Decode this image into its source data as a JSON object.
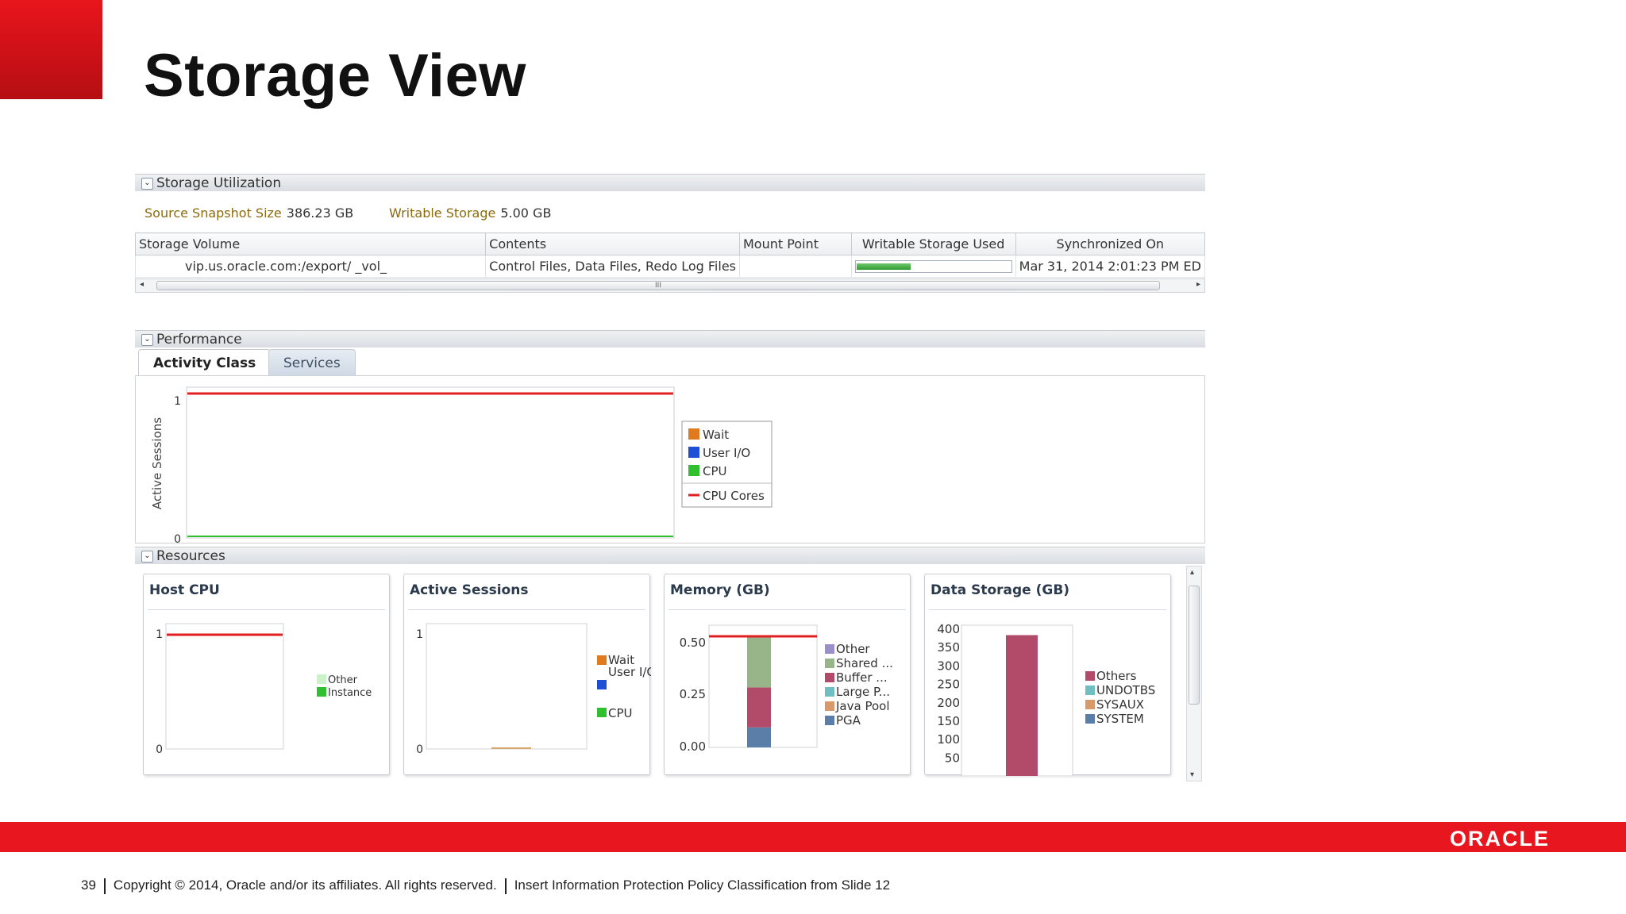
{
  "slide": {
    "title": "Storage View",
    "page_number": "39",
    "copyright": "Copyright © 2014, Oracle and/or its affiliates. All rights reserved.",
    "classification": "Insert Information Protection Policy Classification from Slide 12",
    "logo": "ORACLE",
    "brand_color": "#e8161e"
  },
  "storage_utilization": {
    "header": "Storage Utilization",
    "source_snapshot_label": "Source Snapshot Size",
    "source_snapshot_value": "386.23 GB",
    "writable_storage_label": "Writable Storage",
    "writable_storage_value": "5.00 GB",
    "columns": [
      "Storage Volume",
      "Contents",
      "Mount Point",
      "Writable Storage Used",
      "Synchronized On"
    ],
    "row": {
      "volume": "vip.us.oracle.com:/export/ _vol_",
      "contents": "Control Files, Data Files, Redo Log Files",
      "mount_point": "",
      "writable_used_fraction": 0.35,
      "synchronized_on": "Mar 31, 2014 2:01:23 PM ED"
    },
    "scroll_grip": "III"
  },
  "performance": {
    "header": "Performance",
    "tabs": [
      "Activity Class",
      "Services"
    ],
    "chart_data": {
      "type": "area",
      "ylabel": "Active Sessions",
      "ylim": [
        0,
        1
      ],
      "yticks": [
        "1",
        "0"
      ],
      "series": [
        {
          "name": "Wait",
          "color": "#e07a1f"
        },
        {
          "name": "User I/O",
          "color": "#1f4fd6"
        },
        {
          "name": "CPU",
          "color": "#2fbf2f"
        },
        {
          "name": "CPU Cores",
          "color": "#e02020",
          "value": 1
        }
      ]
    }
  },
  "resources": {
    "header": "Resources",
    "cards": [
      {
        "title": "Host CPU",
        "chart_data": {
          "type": "bar",
          "ylim": [
            0,
            1
          ],
          "yticks": [
            "1",
            "0"
          ],
          "series": [
            {
              "name": "Other",
              "color": "#c9f2c9"
            },
            {
              "name": "Instance",
              "color": "#2fbf2f"
            }
          ]
        }
      },
      {
        "title": "Active Sessions",
        "chart_data": {
          "type": "bar",
          "ylim": [
            0,
            1
          ],
          "yticks": [
            "1",
            "0"
          ],
          "series": [
            {
              "name": "Wait",
              "color": "#e07a1f"
            },
            {
              "name": "User I/O",
              "color": "#1f4fd6"
            },
            {
              "name": "CPU",
              "color": "#2fbf2f"
            }
          ]
        }
      },
      {
        "title": "Memory (GB)",
        "chart_data": {
          "type": "bar",
          "ylim": [
            0,
            0.5
          ],
          "yticks": [
            "0.50",
            "0.25",
            "0.00"
          ],
          "series": [
            {
              "name": "Other",
              "color": "#9b8fc9",
              "value": 0.0
            },
            {
              "name": "Shared ...",
              "color": "#98b58a",
              "value": 0.23
            },
            {
              "name": "Buffer ...",
              "color": "#b24a6a",
              "value": 0.18
            },
            {
              "name": "Large P...",
              "color": "#6fbfc2",
              "value": 0.0
            },
            {
              "name": "Java Pool",
              "color": "#d89a6b",
              "value": 0.0
            },
            {
              "name": "PGA",
              "color": "#5a7ea8",
              "value": 0.09
            }
          ],
          "max_line": 0.5
        }
      },
      {
        "title": "Data Storage (GB)",
        "chart_data": {
          "type": "bar",
          "ylim": [
            0,
            400
          ],
          "yticks": [
            "400",
            "350",
            "300",
            "250",
            "200",
            "150",
            "100",
            "50"
          ],
          "series": [
            {
              "name": "Others",
              "color": "#b24a6a",
              "value": 386
            },
            {
              "name": "UNDOTBS",
              "color": "#6fbfc2",
              "value": 0
            },
            {
              "name": "SYSAUX",
              "color": "#d89a6b",
              "value": 0
            },
            {
              "name": "SYSTEM",
              "color": "#5a7ea8",
              "value": 0
            }
          ]
        }
      }
    ]
  }
}
